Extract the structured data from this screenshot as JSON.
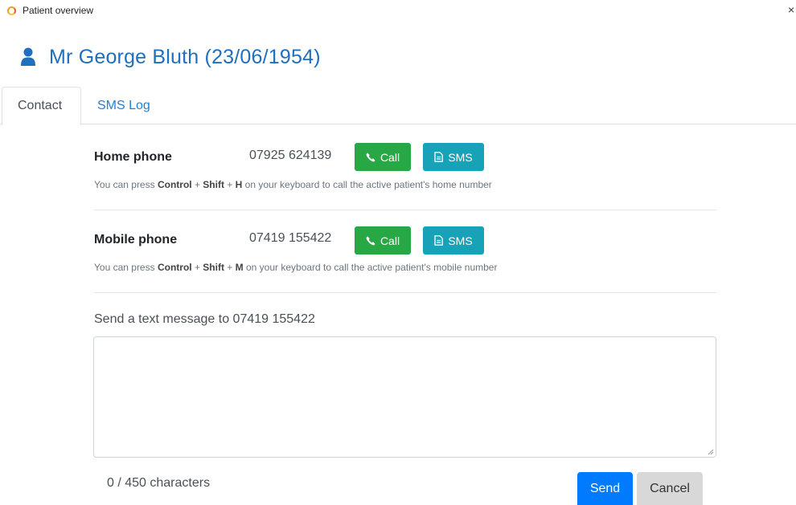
{
  "window": {
    "title": "Patient overview",
    "close_glyph": "×"
  },
  "patient": {
    "name": "Mr George Bluth (23/06/1954)",
    "accent_color": "#1f6fbf"
  },
  "tabs": [
    {
      "label": "Contact",
      "active": true
    },
    {
      "label": "SMS Log",
      "active": false
    }
  ],
  "contacts": [
    {
      "label": "Home phone",
      "number": "07925 624139",
      "call_label": "Call",
      "sms_label": "SMS",
      "hint": {
        "pre": "You can press ",
        "key1": "Control",
        "plus1": " + ",
        "key2": "Shift",
        "plus2": " + ",
        "key3": "H",
        "post": " on your keyboard to call the active patient's home number"
      }
    },
    {
      "label": "Mobile phone",
      "number": "07419 155422",
      "call_label": "Call",
      "sms_label": "SMS",
      "hint": {
        "pre": "You can press ",
        "key1": "Control",
        "plus1": " + ",
        "key2": "Shift",
        "plus2": " + ",
        "key3": "M",
        "post": " on your keyboard to call the active patient's mobile number"
      }
    }
  ],
  "sms": {
    "heading": "Send a text message to 07419 155422",
    "message_value": "",
    "char_count": "0 / 450 characters",
    "send_label": "Send",
    "cancel_label": "Cancel"
  },
  "colors": {
    "call_button": "#28a745",
    "sms_button": "#17a2b8",
    "send_button": "#007bff",
    "cancel_button": "#d8d8d8"
  },
  "icons": [
    "app-loading-icon",
    "close-icon",
    "user-icon",
    "phone-icon",
    "document-icon",
    "resize-grip-icon"
  ]
}
